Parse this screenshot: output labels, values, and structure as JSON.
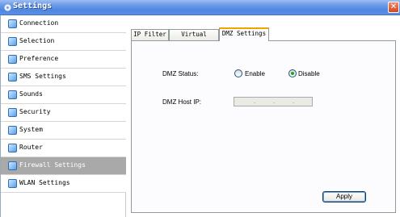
{
  "window": {
    "title": "Settings",
    "close_glyph": "✕"
  },
  "sidebar": {
    "items": [
      {
        "label": "Connection",
        "icon": "connection-icon",
        "active": false
      },
      {
        "label": "Selection",
        "icon": "selection-icon",
        "active": false
      },
      {
        "label": "Preference",
        "icon": "preference-icon",
        "active": false
      },
      {
        "label": "SMS Settings",
        "icon": "sms-icon",
        "active": false
      },
      {
        "label": "Sounds",
        "icon": "sounds-icon",
        "active": false
      },
      {
        "label": "Security",
        "icon": "security-icon",
        "active": false
      },
      {
        "label": "System",
        "icon": "system-icon",
        "active": false
      },
      {
        "label": "Router",
        "icon": "router-icon",
        "active": false
      },
      {
        "label": "Firewall Settings",
        "icon": "firewall-icon",
        "active": true
      },
      {
        "label": "WLAN Settings",
        "icon": "wlan-icon",
        "active": false
      }
    ]
  },
  "tabs": [
    {
      "label": "IP Filter",
      "active": false
    },
    {
      "label": "Virtual Server",
      "active": false
    },
    {
      "label": "DMZ Settings",
      "active": true
    }
  ],
  "dmz": {
    "status_label": "DMZ Status:",
    "enable_label": "Enable",
    "disable_label": "Disable",
    "selected": "Disable",
    "host_ip_label": "DMZ Host IP:",
    "host_ip_value": ""
  },
  "actions": {
    "apply_label": "Apply"
  },
  "colors": {
    "accent_tab": "#f0a400",
    "active_sidebar": "#a9a9a9",
    "title_bar": "#4f86e0"
  }
}
